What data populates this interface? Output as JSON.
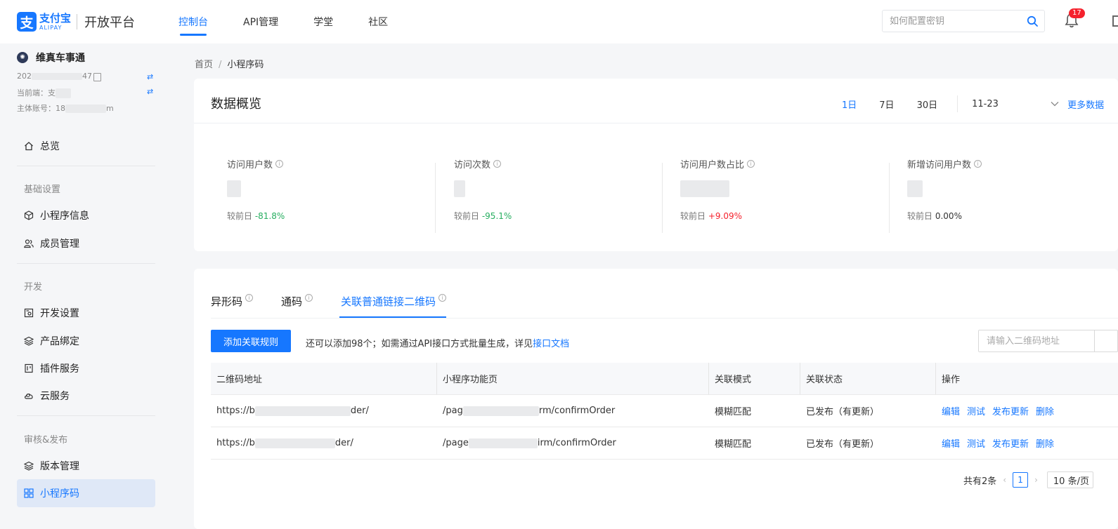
{
  "brand": {
    "logo_glyph": "支",
    "name_cn": "支付宝",
    "name_en": "ALIPAY",
    "platform": "开放平台",
    "color": "#1677ff"
  },
  "nav": {
    "items": [
      {
        "label": "控制台"
      },
      {
        "label": "API管理"
      },
      {
        "label": "学堂"
      },
      {
        "label": "社区"
      }
    ]
  },
  "search": {
    "placeholder": "如何配置密钥"
  },
  "notifications": {
    "count": "17"
  },
  "account": {
    "app_name": "维真车事通",
    "app_id_prefix": "202",
    "app_id_suffix": "47",
    "current_end_label": "当前端：",
    "current_end_value": "支",
    "main_account_label": "主体账号：",
    "main_account_prefix": "18",
    "main_account_suffix": "m"
  },
  "sidebar": {
    "overview": "总览",
    "group_basic": "基础设置",
    "item_info": "小程序信息",
    "item_members": "成员管理",
    "group_dev": "开发",
    "item_dev_settings": "开发设置",
    "item_product": "产品绑定",
    "item_plugin": "插件服务",
    "item_cloud": "云服务",
    "group_publish": "审核&发布",
    "item_version": "版本管理",
    "item_qrcode": "小程序码"
  },
  "breadcrumb": {
    "home": "首页",
    "sep": "/",
    "current": "小程序码"
  },
  "overview": {
    "title": "数据概览",
    "ranges": [
      "1日",
      "7日",
      "30日"
    ],
    "date": "11-23",
    "more": "更多数据",
    "stats": [
      {
        "label": "访问用户数",
        "cmp_label": "较前日",
        "change": "-81.8%"
      },
      {
        "label": "访问次数",
        "cmp_label": "较前日",
        "change": "-95.1%"
      },
      {
        "label": "访问用户数占比",
        "cmp_label": "较前日",
        "change": "+9.09%"
      },
      {
        "label": "新增访问用户数",
        "cmp_label": "较前日",
        "change": "0.00%"
      }
    ],
    "colors": {
      "down": "#27ae60",
      "up": "#f5222d"
    }
  },
  "qrcode": {
    "tabs": [
      "异形码",
      "通码",
      "关联普通链接二维码"
    ],
    "add_button": "添加关联规则",
    "hint_text": "还可以添加98个；如需通过API接口方式批量生成，详见",
    "hint_link": "接口文档",
    "search_placeholder": "请输入二维码地址",
    "columns": [
      "二维码地址",
      "小程序功能页",
      "关联模式",
      "关联状态",
      "操作"
    ],
    "rows": [
      {
        "url_prefix": "https://b",
        "url_suffix": "der/",
        "page_prefix": "/pag",
        "page_suffix": "rm/confirmOrder",
        "mode": "模糊匹配",
        "status": "已发布（有更新）"
      },
      {
        "url_prefix": "https://b",
        "url_suffix": "der/",
        "page_prefix": "/page",
        "page_suffix": "irm/confirmOrder",
        "mode": "模糊匹配",
        "status": "已发布（有更新）"
      }
    ],
    "actions": [
      "编辑",
      "测试",
      "发布更新",
      "删除"
    ],
    "pagination": {
      "total": "共有2条",
      "page": "1",
      "page_size": "10 条/页"
    }
  }
}
